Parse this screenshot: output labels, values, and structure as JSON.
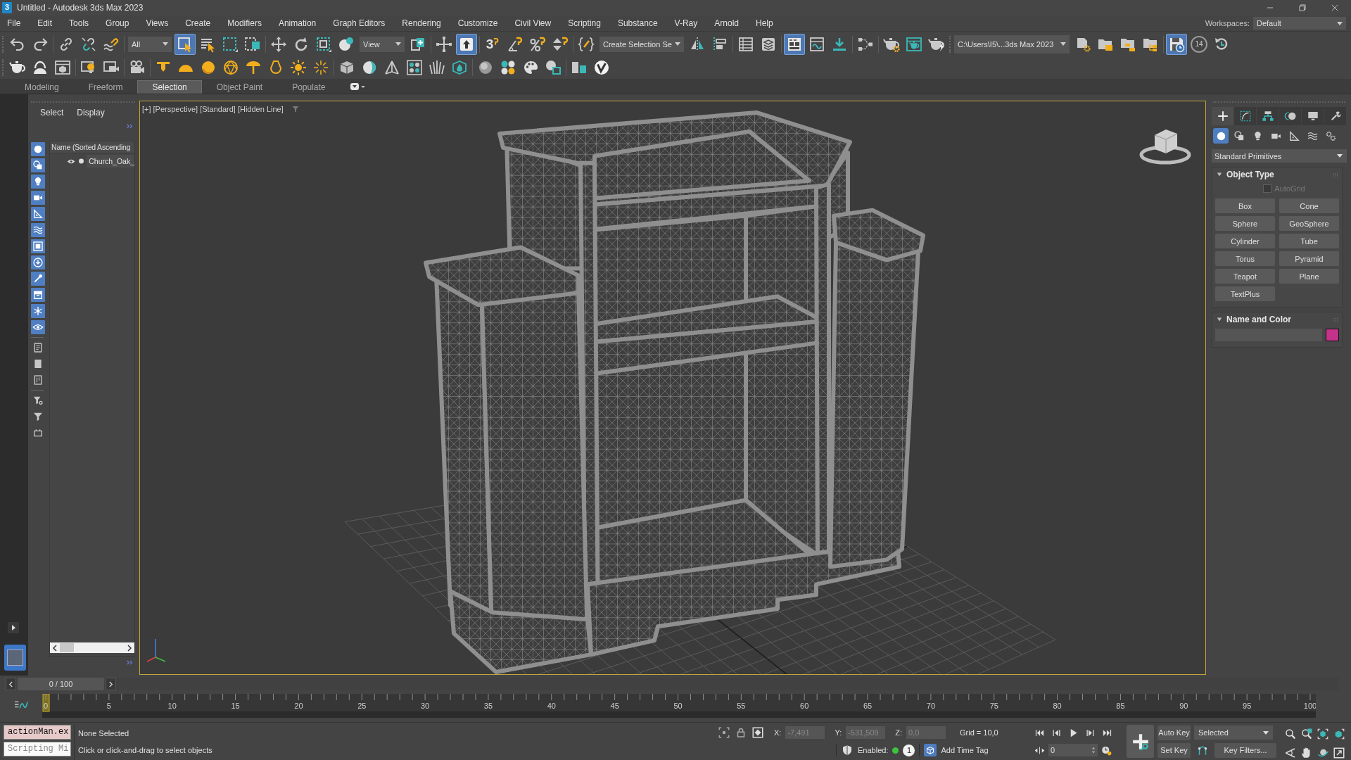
{
  "title_bar": {
    "app_badge": "3",
    "title": "Untitled - Autodesk 3ds Max 2023"
  },
  "menu_bar": {
    "items": [
      "File",
      "Edit",
      "Tools",
      "Group",
      "Views",
      "Create",
      "Modifiers",
      "Animation",
      "Graph Editors",
      "Rendering",
      "Customize",
      "Civil View",
      "Scripting",
      "Substance",
      "V-Ray",
      "Arnold",
      "Help"
    ],
    "workspaces_label": "Workspaces:",
    "workspace": "Default"
  },
  "main_toolbar": {
    "selection_filter": "All",
    "reference_coordinate_system": "View",
    "snap_toggle_label": "3",
    "named_selection_set": "Create Selection Se",
    "project_folder": "C:\\Users\\I5\\...3ds Max 2023",
    "ring_label": "14",
    "buttons": [
      {
        "on": false
      },
      {
        "on": false
      },
      {
        "on": false
      },
      {
        "on": false
      },
      {
        "on": false
      },
      {
        "on": true
      },
      {
        "on": false
      },
      {
        "on": false
      },
      {
        "on": false
      },
      {
        "on": false
      },
      {
        "on": false
      },
      {
        "on": false
      },
      {
        "on": false
      },
      {
        "on": false
      },
      {
        "on": false
      },
      {
        "on": true
      },
      {
        "on": false
      },
      {
        "on": false
      },
      {
        "on": false
      },
      {
        "on": false
      },
      {
        "on": false
      },
      {
        "on": false
      },
      {
        "on": false
      },
      {
        "on": false
      },
      {
        "on": false
      },
      {
        "on": true
      },
      {
        "on": false
      },
      {
        "on": false
      },
      {
        "on": false
      },
      {
        "on": false
      },
      {
        "on": false
      },
      {
        "on": false
      },
      {
        "on": false
      },
      {
        "on": false
      },
      {
        "on": false
      },
      {
        "on": false
      },
      {
        "on": true
      },
      {
        "on": false
      },
      {
        "on": false
      }
    ]
  },
  "ribbon_tabs": [
    {
      "label": "Modeling",
      "selected": false
    },
    {
      "label": "Freeform",
      "selected": false
    },
    {
      "label": "Selection",
      "selected": true
    },
    {
      "label": "Object Paint",
      "selected": false
    },
    {
      "label": "Populate",
      "selected": false
    }
  ],
  "scene_explorer": {
    "menu": [
      "Select",
      "Display"
    ],
    "filters": [
      {
        "on": true
      },
      {
        "on": true
      },
      {
        "on": true
      },
      {
        "on": true
      },
      {
        "on": true
      },
      {
        "on": true
      },
      {
        "on": true
      },
      {
        "on": true
      },
      {
        "on": true
      },
      {
        "on": true
      },
      {
        "on": true
      },
      {
        "on": true
      },
      {
        "on": false
      },
      {
        "on": false
      },
      {
        "on": false
      },
      {
        "on": false
      },
      {
        "on": false
      },
      {
        "on": false
      }
    ],
    "column_header": "Name (Sorted Ascending",
    "rows": [
      {
        "name": "Church_Oak_"
      }
    ]
  },
  "viewport": {
    "active": true,
    "labels": [
      "[+]",
      "[Perspective]",
      "[Standard]",
      "[Hidden Line]"
    ]
  },
  "command_panel": {
    "tabs": [
      {
        "selected": true
      },
      {
        "selected": false
      },
      {
        "selected": false
      },
      {
        "selected": false
      },
      {
        "selected": false
      },
      {
        "selected": false
      }
    ],
    "categories": [
      {
        "selected": true
      },
      {
        "selected": false
      },
      {
        "selected": false
      },
      {
        "selected": false
      },
      {
        "selected": false
      },
      {
        "selected": false
      },
      {
        "selected": false
      }
    ],
    "category_dropdown": "Standard Primitives",
    "rollouts": [
      {
        "kind": "object_type",
        "title": "Object Type",
        "expanded": true,
        "autogrid": {
          "label": "AutoGrid",
          "checked": false,
          "disabled": true
        },
        "buttons": [
          "Box",
          "Cone",
          "Sphere",
          "GeoSphere",
          "Cylinder",
          "Tube",
          "Torus",
          "Pyramid",
          "Teapot",
          "Plane",
          "TextPlus"
        ]
      },
      {
        "kind": "name_and_color",
        "title": "Name and Color",
        "expanded": true,
        "color": "#c3328b"
      }
    ]
  },
  "time_slider": {
    "label": "0 / 100",
    "level": 0
  },
  "track_bar": {
    "frame_labels": [
      "0",
      "5",
      "10",
      "15",
      "20",
      "25",
      "30",
      "35",
      "40",
      "45",
      "50",
      "55",
      "60",
      "65",
      "70",
      "75",
      "80",
      "85",
      "90",
      "95",
      "100"
    ]
  },
  "status_bar": {
    "listener": {
      "output": "actionMan.ex",
      "input": "Scripting Mi"
    },
    "selection_status": "None Selected",
    "prompt": "Click or click-and-drag to select objects",
    "coordinates": [
      {
        "axis": "X:",
        "value": "-7,491",
        "disabled": true
      },
      {
        "axis": "Y:",
        "value": "-531,509",
        "disabled": true
      },
      {
        "axis": "Z:",
        "value": "0,0",
        "disabled": true
      }
    ],
    "grid": "Grid = 10,0",
    "time_tags": {
      "label": "Enabled:",
      "enabled": true,
      "count": "1",
      "add_label": "Add Time Tag"
    }
  },
  "animation_controls": {
    "current_frame": "0",
    "auto_key": {
      "label": "Auto Key",
      "on": false
    },
    "key_set": "Selected",
    "set_key": "Set Key",
    "key_filters": "Key Filters..."
  }
}
